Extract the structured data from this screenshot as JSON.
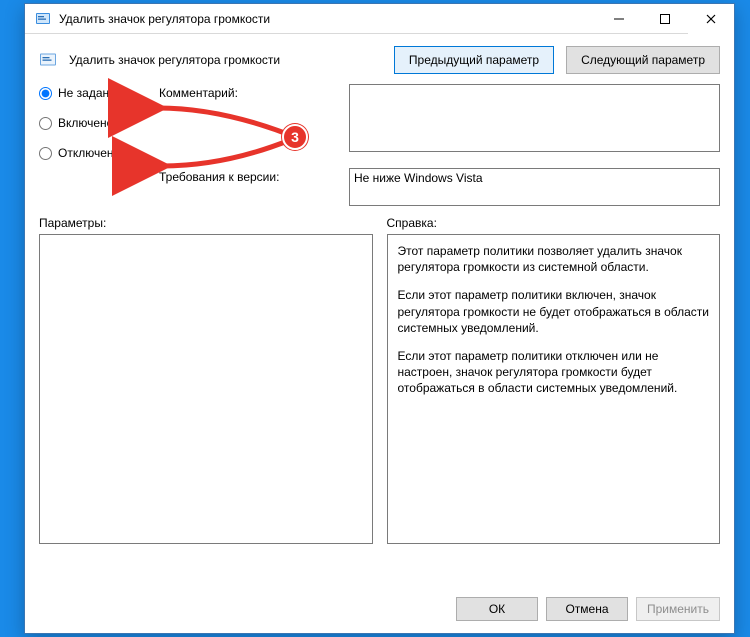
{
  "window": {
    "title": "Удалить значок регулятора громкости"
  },
  "header": {
    "policy_title": "Удалить значок регулятора громкости",
    "prev_btn": "Предыдущий параметр",
    "next_btn": "Следующий параметр"
  },
  "radios": {
    "not_configured": "Не задано",
    "enabled": "Включено",
    "disabled": "Отключено",
    "selected": "not_configured"
  },
  "labels": {
    "comment": "Комментарий:",
    "requirements": "Требования к версии:",
    "options": "Параметры:",
    "help": "Справка:"
  },
  "fields": {
    "comment_value": "",
    "requirements_value": "Не ниже Windows Vista"
  },
  "help_paragraphs": [
    "Этот параметр политики позволяет удалить значок регулятора громкости из системной области.",
    "Если этот параметр политики включен, значок регулятора громкости не будет отображаться в области системных уведомлений.",
    "Если этот параметр политики отключен или не настроен, значок регулятора громкости будет отображаться в области системных уведомлений."
  ],
  "footer": {
    "ok": "ОК",
    "cancel": "Отмена",
    "apply": "Применить"
  },
  "annotation": {
    "badge": "3"
  }
}
